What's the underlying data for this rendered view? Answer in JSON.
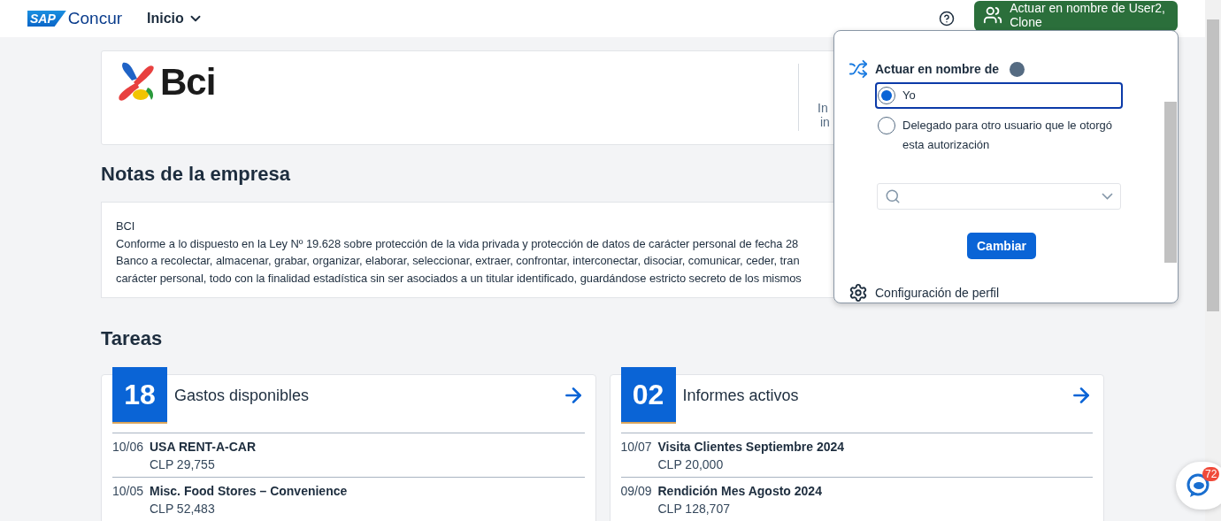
{
  "topbar": {
    "logo_badge": "SAP",
    "logo_text": "Concur",
    "nav": {
      "label": "Inicio"
    },
    "acting_button": {
      "line1": "Actuar en nombre de User2,",
      "line2": "Clone"
    }
  },
  "company_header": {
    "logo_text": "Bci",
    "side_texts": [
      "In",
      "in"
    ]
  },
  "company_notes": {
    "title": "Notas de la empresa",
    "lines": [
      "BCI",
      "Conforme a lo dispuesto en la Ley Nº 19.628 sobre protección de la vida privada y protección de datos de carácter personal de fecha 28",
      "Banco a recolectar, almacenar, grabar, organizar, elaborar, seleccionar, extraer, confrontar, interconectar, disociar, comunicar, ceder, tran",
      "carácter personal, todo con la finalidad estadística sin ser asociados a un titular identificado, guardándose estricto secreto de los mismos"
    ]
  },
  "tasks": {
    "title": "Tareas",
    "cards": [
      {
        "count": "18",
        "title": "Gastos disponibles",
        "items": [
          {
            "date": "10/06",
            "name": "USA RENT-A-CAR",
            "amount": "CLP 29,755"
          },
          {
            "date": "10/05",
            "name": "Misc. Food Stores – Convenience",
            "amount": "CLP 52,483"
          }
        ]
      },
      {
        "count": "02",
        "title": "Informes activos",
        "items": [
          {
            "date": "10/07",
            "name": "Visita Clientes Septiembre 2024",
            "amount": "CLP 20,000"
          },
          {
            "date": "09/09",
            "name": "Rendición Mes Agosto 2024",
            "amount": "CLP 128,707"
          }
        ]
      }
    ]
  },
  "act_as_menu": {
    "heading": "Actuar en nombre de",
    "options": [
      {
        "label": "Yo",
        "selected": true
      },
      {
        "label": "Delegado para otro usuario que le otorgó esta autorización",
        "selected": false
      }
    ],
    "submit": "Cambiar",
    "profile_link": "Configuración de perfil"
  },
  "chat_widget": {
    "badge": "72"
  }
}
